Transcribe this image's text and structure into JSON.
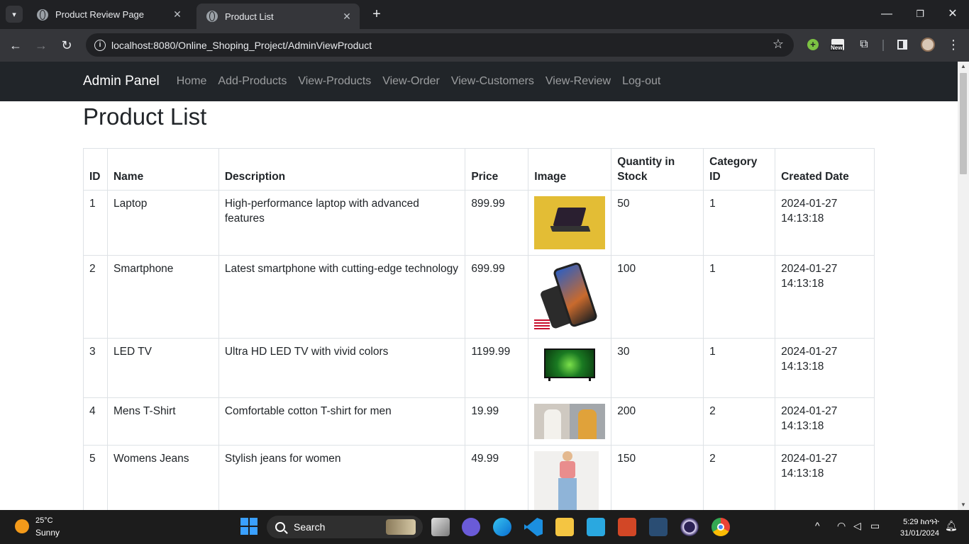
{
  "browser": {
    "tabs": [
      {
        "title": "Product Review Page"
      },
      {
        "title": "Product List"
      }
    ],
    "url": "localhost:8080/Online_Shoping_Project/AdminViewProduct"
  },
  "navbar": {
    "brand": "Admin Panel",
    "links": [
      "Home",
      "Add-Products",
      "View-Products",
      "View-Order",
      "View-Customers",
      "View-Review",
      "Log-out"
    ]
  },
  "page": {
    "title": "Product List"
  },
  "table": {
    "headers": {
      "id": "ID",
      "name": "Name",
      "description": "Description",
      "price": "Price",
      "image": "Image",
      "qty": "Quantity in Stock",
      "category": "Category ID",
      "created": "Created Date"
    },
    "rows": [
      {
        "id": "1",
        "name": "Laptop",
        "description": "High-performance laptop with advanced features",
        "price": "899.99",
        "qty": "50",
        "category": "1",
        "date": "2024-01-27",
        "time": "14:13:18",
        "image": "laptop-image"
      },
      {
        "id": "2",
        "name": "Smartphone",
        "description": "Latest smartphone with cutting-edge technology",
        "price": "699.99",
        "qty": "100",
        "category": "1",
        "date": "2024-01-27",
        "time": "14:13:18",
        "image": "smartphone-image"
      },
      {
        "id": "3",
        "name": "LED TV",
        "description": "Ultra HD LED TV with vivid colors",
        "price": "1199.99",
        "qty": "30",
        "category": "1",
        "date": "2024-01-27",
        "time": "14:13:18",
        "image": "tv-image"
      },
      {
        "id": "4",
        "name": "Mens T-Shirt",
        "description": "Comfortable cotton T-shirt for men",
        "price": "19.99",
        "qty": "200",
        "category": "2",
        "date": "2024-01-27",
        "time": "14:13:18",
        "image": "tshirt-image"
      },
      {
        "id": "5",
        "name": "Womens Jeans",
        "description": "Stylish jeans for women",
        "price": "49.99",
        "qty": "150",
        "category": "2",
        "date": "2024-01-27",
        "time": "14:13:18",
        "image": "jeans-image"
      }
    ]
  },
  "taskbar": {
    "weather_temp": "25°C",
    "weather_desc": "Sunny",
    "search_label": "Search",
    "time": "5:29 ከሰዓት",
    "date": "31/01/2024"
  },
  "colors": {
    "navbar_bg": "#212529",
    "chrome_dark": "#202124",
    "chrome_toolbar": "#35363a"
  }
}
